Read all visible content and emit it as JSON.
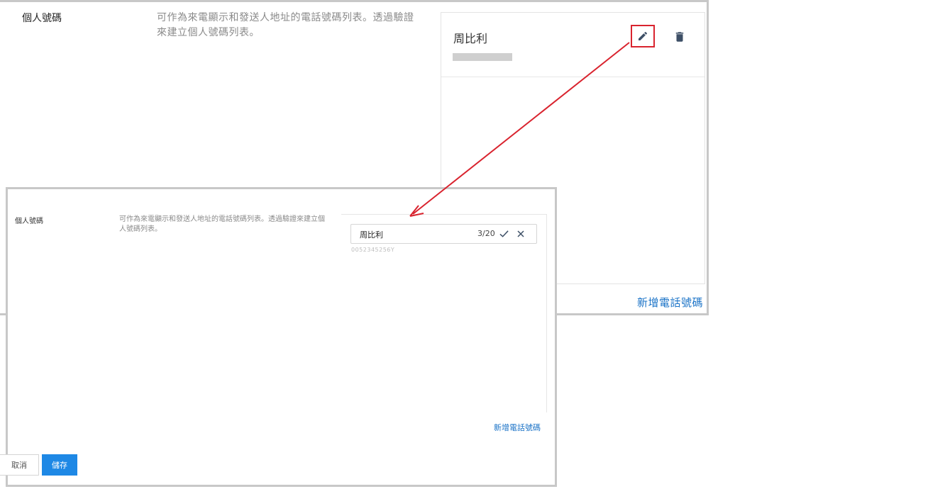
{
  "top_screen": {
    "section_label": "個人號碼",
    "description": "可作為來電顯示和發送人地址的電話號碼列表。透過驗證來建立個人號碼列表。",
    "contact_name": "周比利",
    "add_phone_link": "新增電話號碼"
  },
  "bottom_screen": {
    "section_label": "個人號碼",
    "description": "可作為來電顯示和發送人地址的電話號碼列表。透過驗證來建立個人號碼列表。",
    "name_input_value": "周比利",
    "char_counter": "3/20",
    "phone_number": "0052345256Y",
    "add_phone_link": "新增電話號碼",
    "cancel_label": "取消",
    "save_label": "儲存"
  },
  "colors": {
    "accent_blue": "#1e88e5",
    "link_blue": "#1b73c7",
    "annotation_red": "#d9232e"
  }
}
